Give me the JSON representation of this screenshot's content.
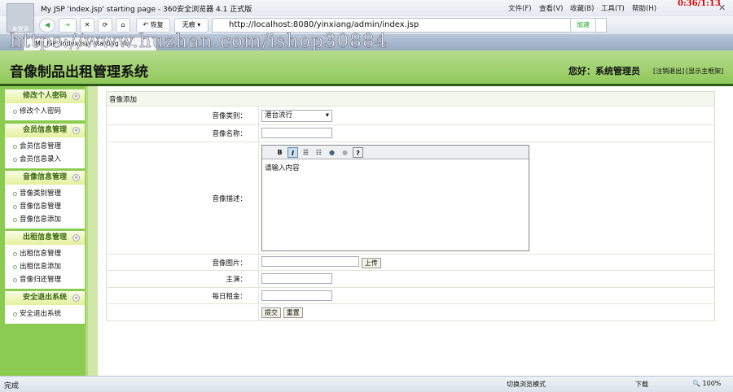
{
  "browser": {
    "title": "My JSP 'index.jsp' starting page - 360安全浏览器 4.1 正式版",
    "avatar_label": "未登录",
    "menus": [
      "文件(F)",
      "查看(V)",
      "收藏(B)",
      "工具(T)",
      "帮助(H)"
    ],
    "clock": "0:36/1:13",
    "restore": "恢复",
    "no_trace": "无痕",
    "url": "http://localhost:8080/yinxiang/admin/index.jsp",
    "accelerate": "加速",
    "tab": "My JSP 'index.jsp' starting pa...",
    "watermark": "https://www.huzhan.com/ishop30884",
    "status": "完成",
    "switch_mode": "切换浏览模式",
    "download": "下载",
    "zoom": "100%"
  },
  "header": {
    "title": "音像制品出租管理系统",
    "greeting": "您好：系统管理员",
    "logout": "[注销退出]",
    "show_frame": "[显示主框架]"
  },
  "sidebar": [
    {
      "title": "修改个人密码",
      "items": [
        "修改个人密码"
      ]
    },
    {
      "title": "会员信息管理",
      "items": [
        "会员信息管理",
        "会员信息录入"
      ]
    },
    {
      "title": "音像信息管理",
      "items": [
        "音像类别管理",
        "音像信息管理",
        "音像信息添加"
      ]
    },
    {
      "title": "出租信息管理",
      "items": [
        "出租信息管理",
        "出租信息添加",
        "音像归还管理"
      ]
    },
    {
      "title": "安全退出系统",
      "items": [
        "安全退出系统"
      ]
    }
  ],
  "form": {
    "title": "音像添加",
    "category_label": "音像类别：",
    "category_value": "港台流行",
    "name_label": "音像名称：",
    "desc_label": "音像描述：",
    "desc_placeholder": "请输入内容",
    "image_label": "音像图片：",
    "upload": "上传",
    "actor_label": "主演：",
    "rent_label": "每日租金：",
    "submit": "提交",
    "reset": "重置"
  }
}
